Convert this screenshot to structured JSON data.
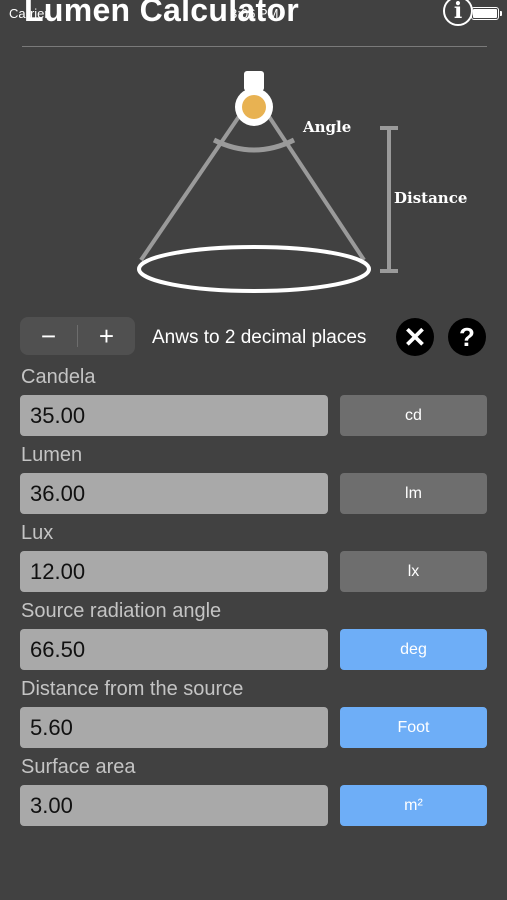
{
  "status_bar": {
    "carrier": "Carrier",
    "time": "3:06 PM"
  },
  "header": {
    "title": "Lumen Calculator",
    "info_icon": "info-circle-icon"
  },
  "diagram": {
    "angle_label": "Angle",
    "distance_label": "Distance"
  },
  "controls": {
    "decrement": "−",
    "increment": "+",
    "decimal_text": "Anws to 2 decimal places",
    "clear_icon": "clear-x-icon",
    "help_icon": "question-icon"
  },
  "colors": {
    "background": "#414141",
    "input_bg": "#a9a9a9",
    "unit_gray": "#6e6e6e",
    "unit_blue": "#6eaef7",
    "bulb": "#e8b252"
  },
  "fields": [
    {
      "label": "Candela",
      "value": "35.00",
      "unit": "cd",
      "unit_style": "gray"
    },
    {
      "label": "Lumen",
      "value": "36.00",
      "unit": "lm",
      "unit_style": "gray"
    },
    {
      "label": "Lux",
      "value": "12.00",
      "unit": "lx",
      "unit_style": "gray"
    },
    {
      "label": "Source radiation angle",
      "value": "66.50",
      "unit": "deg",
      "unit_style": "blue"
    },
    {
      "label": "Distance from the source",
      "value": "5.60",
      "unit": "Foot",
      "unit_style": "blue"
    },
    {
      "label": "Surface area",
      "value": "3.00",
      "unit": "m²",
      "unit_style": "blue"
    }
  ]
}
